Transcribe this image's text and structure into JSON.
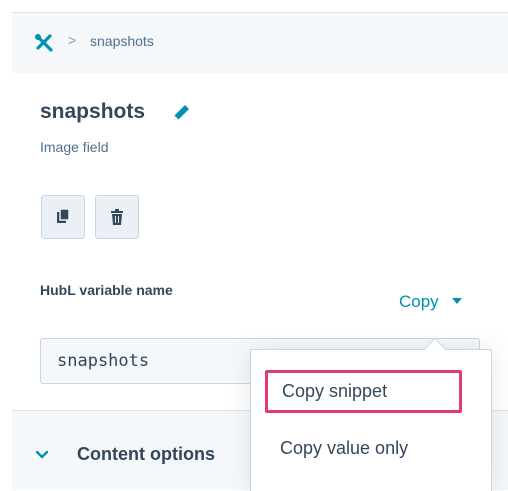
{
  "breadcrumb": {
    "separator": ">",
    "current": "snapshots",
    "icon": "tools-icon"
  },
  "field": {
    "title": "snapshots",
    "type_label": "Image field",
    "edit_icon": "pencil-icon"
  },
  "actions": {
    "clone_icon": "clone-icon",
    "delete_icon": "trash-icon"
  },
  "hubl": {
    "label": "HubL variable name",
    "copy_label": "Copy",
    "value": "snapshots"
  },
  "copy_menu": {
    "items": [
      {
        "label": "Copy snippet",
        "highlighted": true
      },
      {
        "label": "Copy value only"
      }
    ]
  },
  "content_options": {
    "label": "Content options",
    "icon": "chevron-down-icon"
  },
  "colors": {
    "accent": "#0091ae",
    "highlight": "#e33a6b",
    "text": "#33475b",
    "panel": "#f5f8fa"
  }
}
